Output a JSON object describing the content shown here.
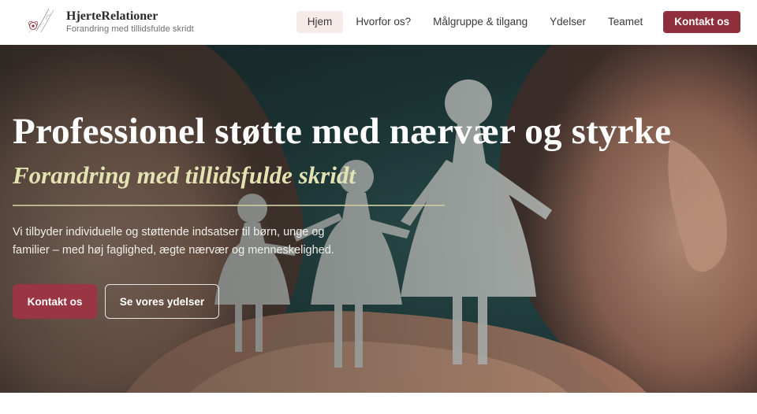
{
  "header": {
    "logo_icon": "floral-logo-icon",
    "brand_name": "HjerteRelationer",
    "brand_tagline": "Forandring med tillidsfulde skridt",
    "nav": [
      {
        "label": "Hjem",
        "active": true
      },
      {
        "label": "Hvorfor os?",
        "active": false
      },
      {
        "label": "Målgruppe & tilgang",
        "active": false
      },
      {
        "label": "Ydelser",
        "active": false
      },
      {
        "label": "Teamet",
        "active": false
      }
    ],
    "cta_label": "Kontakt os"
  },
  "hero": {
    "background_image": "paper-cutout-family-in-hands",
    "title": "Professionel støtte med nærvær og styrke",
    "subtitle": "Forandring med tillidsfulde skridt",
    "description": "Vi tilbyder individuelle og støttende indsatser til børn, unge og familier – med høj faglighed, ægte nærvær og menneskelighed.",
    "primary_button": "Kontakt os",
    "secondary_button": "Se vores ydelser"
  },
  "colors": {
    "accent": "#8e2f3b",
    "accent_button": "#9a3644",
    "subtitle": "#e3e2b3",
    "nav_active_bg": "#f6ebe9"
  }
}
